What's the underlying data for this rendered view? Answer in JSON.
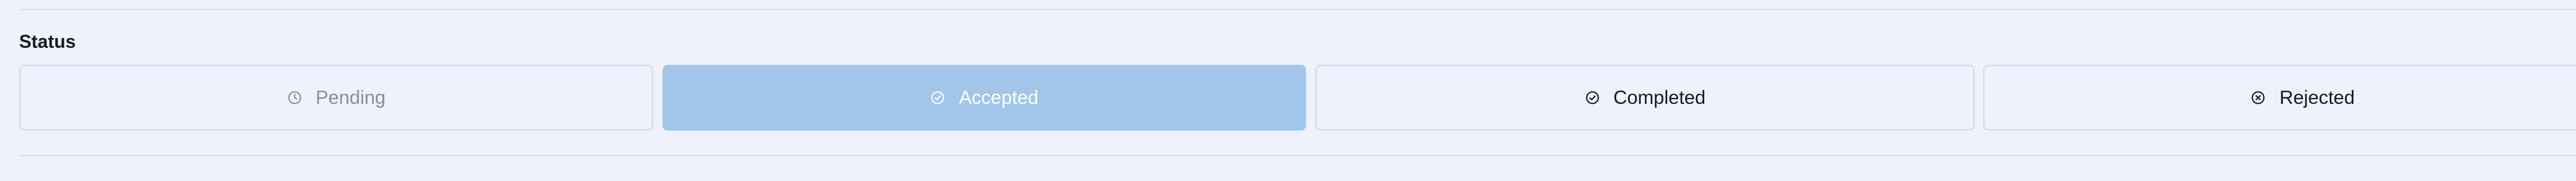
{
  "status_section": {
    "label": "Status",
    "options": [
      {
        "label": "Pending",
        "icon": "clock-icon",
        "state": "disabled"
      },
      {
        "label": "Accepted",
        "icon": "check-circle-icon",
        "state": "selected"
      },
      {
        "label": "Completed",
        "icon": "check-circle-icon",
        "state": "default"
      },
      {
        "label": "Rejected",
        "icon": "x-circle-icon",
        "state": "default"
      }
    ]
  },
  "colors": {
    "background": "#eff2fd",
    "selected_fill": "#a1c6ea",
    "border": "#d8dcea",
    "text": "#151b2b",
    "disabled_text": "#8a8e9b"
  }
}
